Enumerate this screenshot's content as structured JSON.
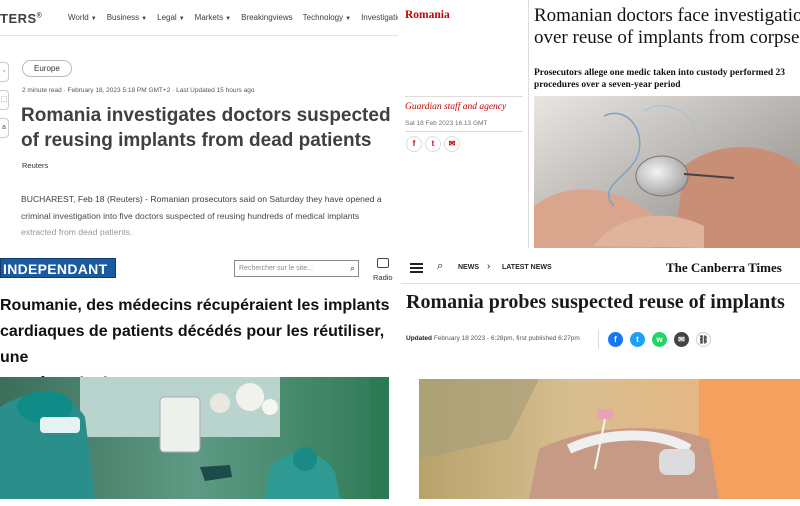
{
  "reuters": {
    "logo": "TERS",
    "nav": [
      "World",
      "Business",
      "Legal",
      "Markets",
      "Breakingviews",
      "Technology",
      "Investigations"
    ],
    "side_buttons": [
      "◦",
      "⬚",
      "a"
    ],
    "tag": "Europe",
    "meta": "2 minute read · February 18, 2023 5:18 PM GMT+2 · Last Updated 15 hours ago",
    "headline": "Romania investigates doctors suspected of reusing implants from dead patients",
    "byline": "Reuters",
    "body": "BUCHAREST, Feb 18 (Reuters) - Romanian prosecutors said on Saturday they have opened a criminal investigation into five doctors suspected of reusing hundreds of medical implants extracted from dead patients."
  },
  "guardian": {
    "section": "Romania",
    "headline_line1": "Romanian doctors face investigation",
    "headline_line2": "over reuse of implants from corpses",
    "standfirst_line1": "Prosecutors allege one medic taken into custody performed 23",
    "standfirst_line2": "procedures over a seven-year period",
    "author": "Guardian staff and agency",
    "date": "Sat 18 Feb 2023 16.13 GMT",
    "share_icons": [
      "f",
      "t",
      "✉"
    ]
  },
  "independant": {
    "logo": "INDEPENDANT",
    "search_placeholder": "Rechercher sur le site...",
    "radio_label": "Radio",
    "headline_line1": "Roumanie, des médecins récupéraient les implants",
    "headline_line2": "cardiaques de patients décédés pour les réutiliser, une",
    "headline_line3": "enquête pénale ouverte"
  },
  "canberra": {
    "nav_news": "NEWS",
    "nav_latest": "LATEST NEWS",
    "masthead": "The Canberra Times",
    "headline": "Romania probes suspected reuse of implants",
    "meta_label": "Updated",
    "meta_value": "February 18 2023 - 6:28pm, first published 6:27pm",
    "share_icons": [
      "f",
      "t",
      "w",
      "✉",
      "⛓"
    ],
    "colors": {
      "facebook": "#1877f2",
      "twitter": "#1da1f2",
      "whatsapp": "#25d366",
      "email": "#444444",
      "link": "#ffffff"
    }
  }
}
